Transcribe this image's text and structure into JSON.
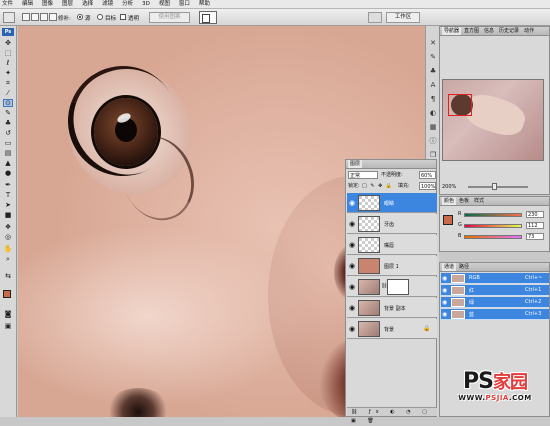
{
  "menu": [
    "文件",
    "编辑",
    "图像",
    "图层",
    "选择",
    "滤镜",
    "分析",
    "3D",
    "视图",
    "窗口",
    "帮助"
  ],
  "options": {
    "patch_label": "修补:",
    "source_label": "源",
    "target_label": "目标",
    "transparent_label": "透明",
    "use_pattern_label": "使用图案",
    "workspace_label": "工作区"
  },
  "toolbox": {
    "logo": "Ps"
  },
  "navigator": {
    "tabs": [
      "导航器",
      "直方图",
      "信息",
      "历史记录",
      "动作"
    ],
    "zoom": "200%"
  },
  "color_panel": {
    "tabs": [
      "颜色",
      "色板",
      "样式"
    ],
    "foreground": "#c86a4a",
    "channels": [
      {
        "label": "R",
        "value": "230"
      },
      {
        "label": "G",
        "value": "112"
      },
      {
        "label": "B",
        "value": "73"
      }
    ]
  },
  "channels_panel": {
    "tabs": [
      "通道",
      "路径"
    ],
    "rows": [
      {
        "name": "RGB",
        "key": "Ctrl+~"
      },
      {
        "name": "红",
        "key": "Ctrl+1"
      },
      {
        "name": "绿",
        "key": "Ctrl+2"
      },
      {
        "name": "蓝",
        "key": "Ctrl+3"
      }
    ]
  },
  "layers_panel": {
    "tabs": [
      "图层"
    ],
    "blend_mode": "正常",
    "opacity_label": "不透明度:",
    "opacity": "60%",
    "lock_label": "锁定:",
    "fill_label": "填充:",
    "fill": "100%",
    "layers": [
      {
        "name": "眼睛",
        "thumb": "empty",
        "selected": true
      },
      {
        "name": "牙齿",
        "thumb": "empty",
        "selected": false
      },
      {
        "name": "嘴唇",
        "thumb": "empty",
        "selected": false
      },
      {
        "name": "图层 1",
        "thumb": "fill",
        "selected": false
      },
      {
        "name": "",
        "thumb": "photo",
        "selected": false,
        "has_mask": true
      },
      {
        "name": "背景 副本",
        "thumb": "photo",
        "selected": false
      },
      {
        "name": "背景",
        "thumb": "photo",
        "selected": false,
        "locked": true
      }
    ]
  },
  "watermark": {
    "logo_ps": "PS",
    "logo_cn": "家园",
    "url_prefix": "WWW.",
    "url_domain": "PSJIA",
    "url_suffix": ".COM"
  }
}
